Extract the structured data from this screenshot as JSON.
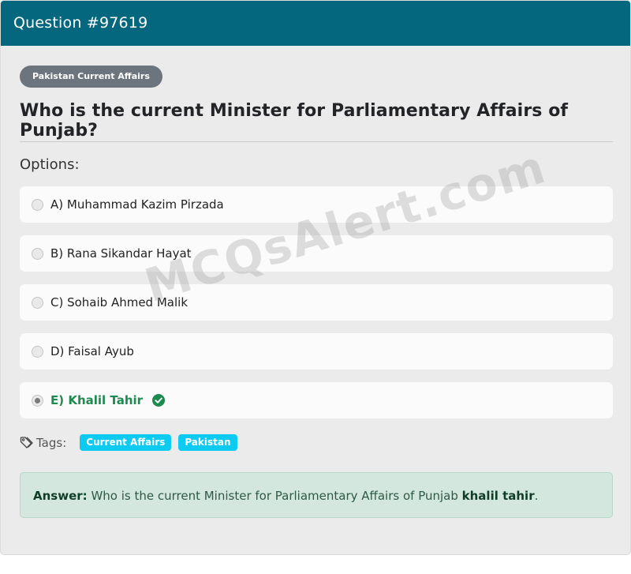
{
  "header": {
    "title": "Question #97619"
  },
  "question": {
    "category": "Pakistan Current Affairs",
    "text": "Who is the current Minister for Parliamentary Affairs of Punjab?",
    "options_heading": "Options:",
    "options": [
      {
        "label": "A) Muhammad Kazim Pirzada",
        "selected": false,
        "correct": false
      },
      {
        "label": "B) Rana Sikandar Hayat",
        "selected": false,
        "correct": false
      },
      {
        "label": "C) Sohaib Ahmed Malik",
        "selected": false,
        "correct": false
      },
      {
        "label": "D) Faisal Ayub",
        "selected": false,
        "correct": false
      },
      {
        "label": "E) Khalil Tahir",
        "selected": true,
        "correct": true
      }
    ]
  },
  "tags": {
    "label": "Tags:",
    "items": [
      "Current Affairs",
      "Pakistan"
    ],
    "icon": "tag-icon"
  },
  "answer": {
    "prefix": "Answer:",
    "text": "Who is the current Minister for Parliamentary Affairs of Punjab",
    "value": "khalil tahir",
    "suffix": "."
  },
  "watermark": "MCQsAlert.com",
  "colors": {
    "header_bg": "#04677d",
    "correct": "#1d8a4f",
    "tag_bg": "#0dcaf0",
    "answer_bg": "#d3e7df"
  }
}
